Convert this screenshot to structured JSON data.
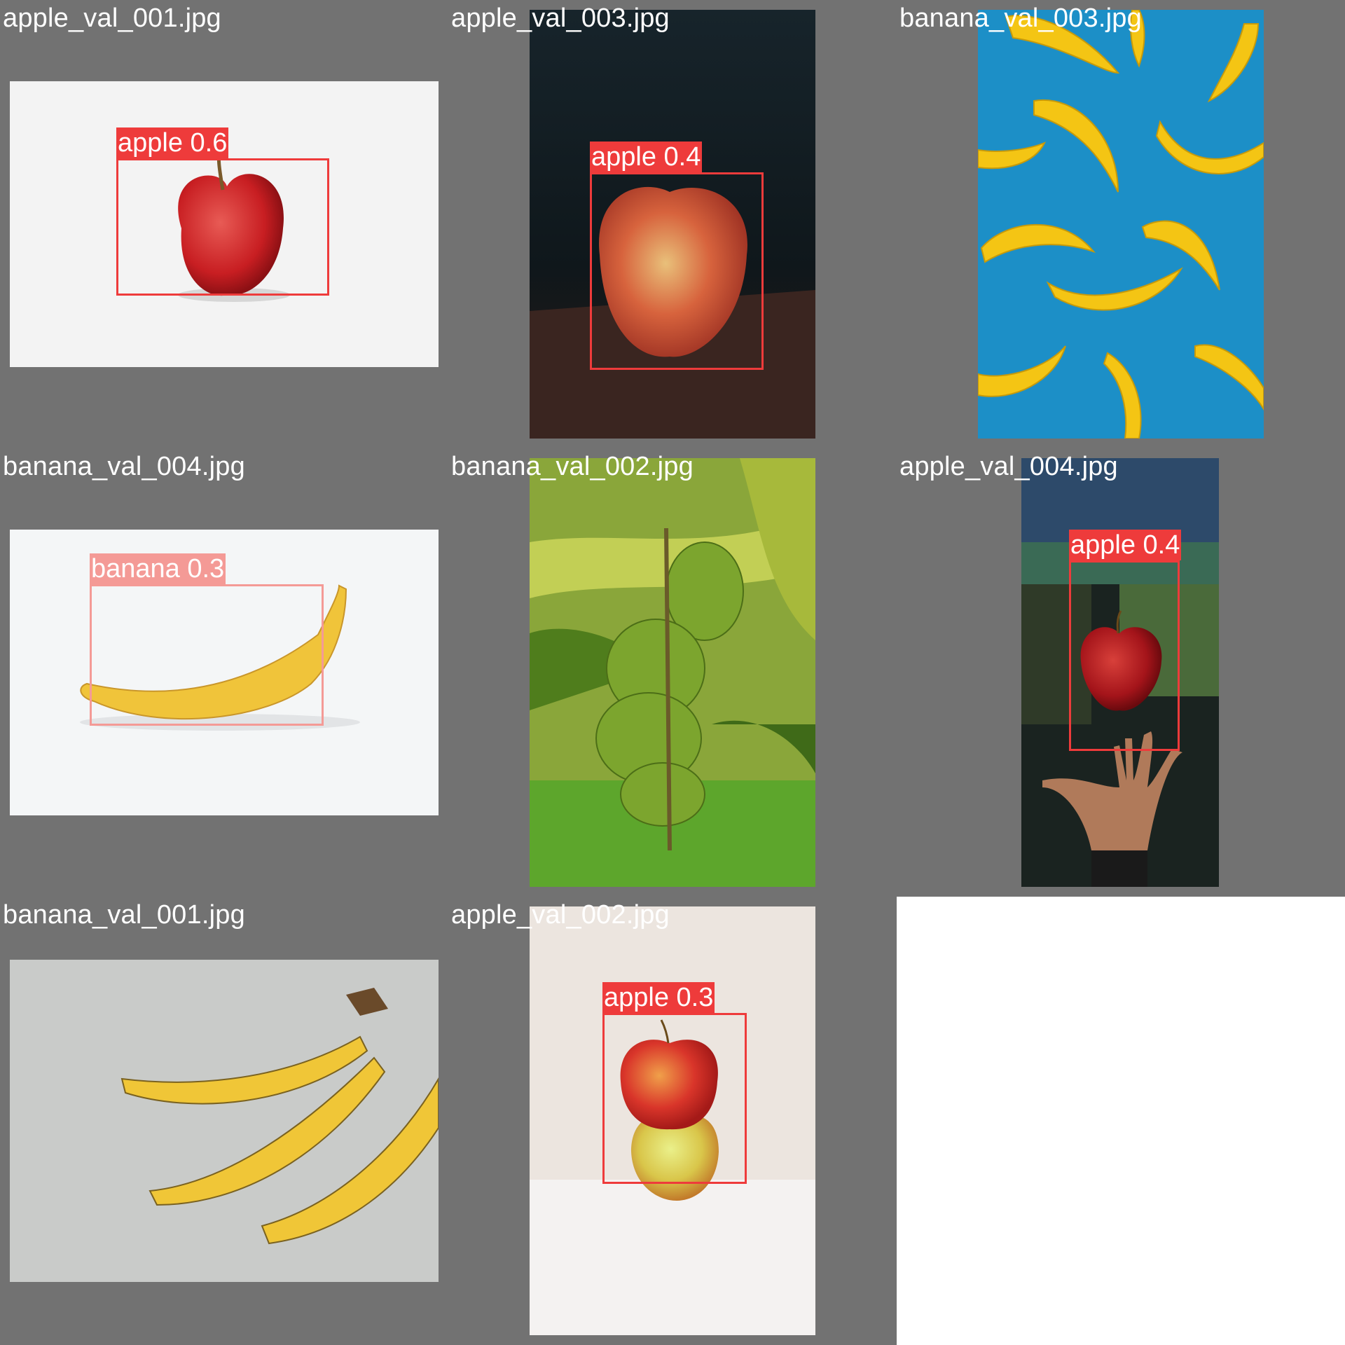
{
  "tiles": [
    {
      "file": "apple_val_001.jpg",
      "detections": [
        {
          "label": "apple 0.6"
        }
      ]
    },
    {
      "file": "apple_val_003.jpg",
      "detections": [
        {
          "label": "apple 0.4"
        }
      ]
    },
    {
      "file": "banana_val_003.jpg",
      "detections": []
    },
    {
      "file": "banana_val_004.jpg",
      "detections": [
        {
          "label": "banana 0.3"
        }
      ]
    },
    {
      "file": "banana_val_002.jpg",
      "detections": []
    },
    {
      "file": "apple_val_004.jpg",
      "detections": [
        {
          "label": "apple 0.4"
        }
      ]
    },
    {
      "file": "banana_val_001.jpg",
      "detections": []
    },
    {
      "file": "apple_val_002.jpg",
      "detections": [
        {
          "label": "apple 0.3"
        }
      ]
    }
  ],
  "colors": {
    "apple_box": "#ee3b3b",
    "banana_box": "#f49a96",
    "tile_bg": "#727272"
  }
}
